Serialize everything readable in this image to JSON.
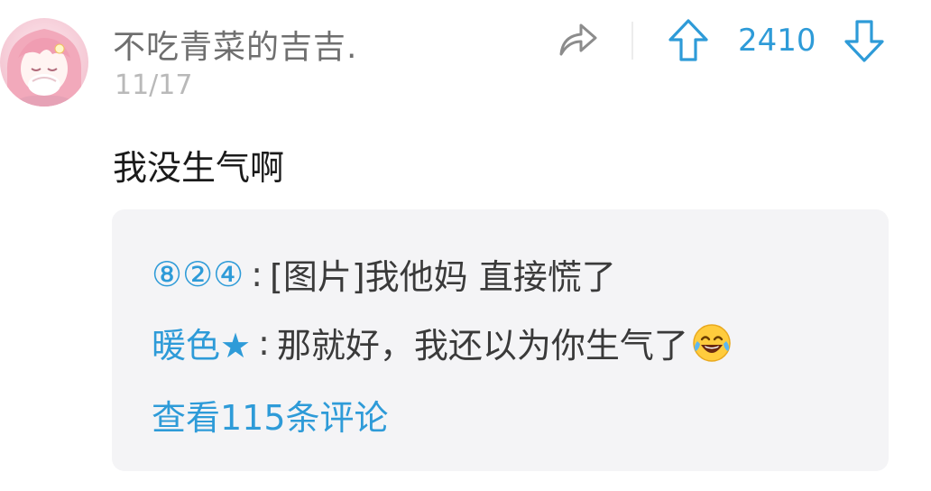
{
  "comment": {
    "username": "不吃青菜的吉吉.",
    "date": "11/17",
    "text": "我没生气啊",
    "score": "2410",
    "avatar_icon": "anime-girl-avatar",
    "share_icon": "share-arrow-icon",
    "upvote_icon": "upvote-arrow-icon",
    "downvote_icon": "downvote-arrow-icon"
  },
  "replies": [
    {
      "author": "⑧②④",
      "separator": ":",
      "text": "[图片]我他妈  直接慌了"
    },
    {
      "author": "暖色★",
      "separator": ":",
      "text": "那就好，我还以为你生气了",
      "emoji": "laughing-crying-emoji"
    }
  ],
  "view_more": "查看115条评论",
  "colors": {
    "accent": "#2e9bd8",
    "reply_bg": "#f4f4f6",
    "username": "#6f6f6f",
    "date": "#b9b9b9"
  }
}
